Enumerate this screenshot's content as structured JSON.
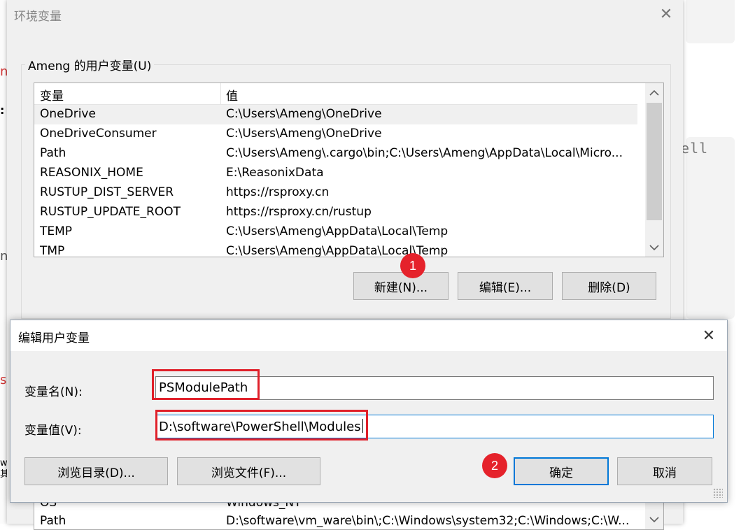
{
  "background": {
    "code_fragment": "nell",
    "fragments": [
      "n",
      ":",
      "n",
      "s",
      "w\n其"
    ]
  },
  "env_dialog": {
    "title": "环境变量",
    "close_glyph": "✕",
    "user_group_label": "Ameng 的用户变量(U)",
    "columns": [
      "变量",
      "值"
    ],
    "rows": [
      {
        "name": "OneDrive",
        "value": "C:\\Users\\Ameng\\OneDrive"
      },
      {
        "name": "OneDriveConsumer",
        "value": "C:\\Users\\Ameng\\OneDrive"
      },
      {
        "name": "Path",
        "value": "C:\\Users\\Ameng\\.cargo\\bin;C:\\Users\\Ameng\\AppData\\Local\\Micro..."
      },
      {
        "name": "REASONIX_HOME",
        "value": "E:\\ReasonixData"
      },
      {
        "name": "RUSTUP_DIST_SERVER",
        "value": "https://rsproxy.cn"
      },
      {
        "name": "RUSTUP_UPDATE_ROOT",
        "value": "https://rsproxy.cn/rustup"
      },
      {
        "name": "TEMP",
        "value": "C:\\Users\\Ameng\\AppData\\Local\\Temp"
      },
      {
        "name": "TMP",
        "value": "C:\\Users\\Ameng\\AppData\\Local\\Temp"
      }
    ],
    "buttons": {
      "new": "新建(N)...",
      "edit": "编辑(E)...",
      "delete": "删除(D)"
    },
    "system_rows": [
      {
        "name": "OS",
        "value": "Windows_NT"
      },
      {
        "name": "Path",
        "value": "D:\\software\\vm_ware\\bin\\;C:\\Windows\\system32;C:\\Windows;C:\\W..."
      }
    ]
  },
  "edit_dialog": {
    "title": "编辑用户变量",
    "close_glyph": "✕",
    "name_label": "变量名(N):",
    "value_label": "变量值(V):",
    "name_value": "PSModulePath",
    "value_value": "D:\\software\\PowerShell\\Modules",
    "buttons": {
      "browse_dir": "浏览目录(D)...",
      "browse_file": "浏览文件(F)...",
      "ok": "确定",
      "cancel": "取消"
    }
  },
  "annotations": {
    "step1": "1",
    "step2": "2"
  },
  "colors": {
    "dialog_bg": "#f0f0f0",
    "annotation_red": "#e5222b",
    "focus_blue": "#0078d7"
  }
}
